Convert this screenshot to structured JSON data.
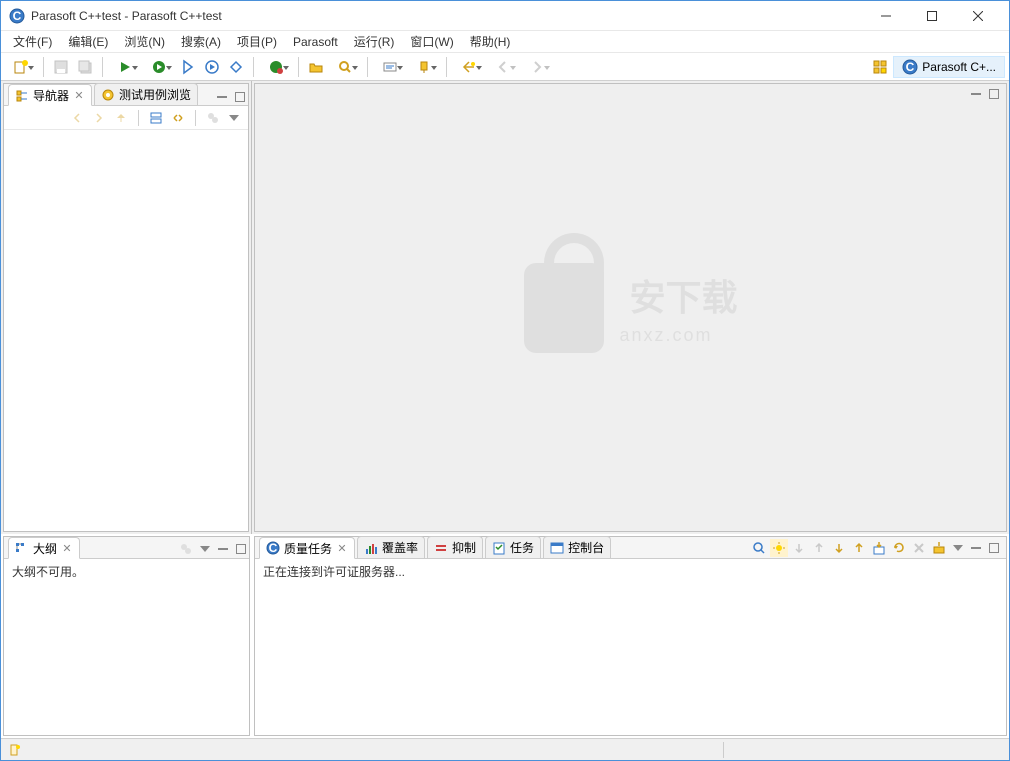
{
  "window": {
    "title": "Parasoft C++test  -  Parasoft C++test"
  },
  "menu": {
    "file": "文件(F)",
    "edit": "编辑(E)",
    "navigate": "浏览(N)",
    "search": "搜索(A)",
    "project": "项目(P)",
    "parasoft": "Parasoft",
    "run": "运行(R)",
    "window": "窗口(W)",
    "help": "帮助(H)"
  },
  "perspective": {
    "label": "Parasoft C+..."
  },
  "views": {
    "navigator": {
      "title": "导航器"
    },
    "testcase": {
      "title": "测试用例浏览"
    },
    "outline": {
      "title": "大纲",
      "empty_text": "大纲不可用。"
    },
    "quality": {
      "title": "质量任务",
      "status": "正在连接到许可证服务器..."
    },
    "coverage": {
      "title": "覆盖率"
    },
    "suppressions": {
      "title": "抑制"
    },
    "tasks": {
      "title": "任务"
    },
    "console": {
      "title": "控制台"
    }
  },
  "watermark": {
    "text": "安下载",
    "sub": "anxz.com"
  }
}
